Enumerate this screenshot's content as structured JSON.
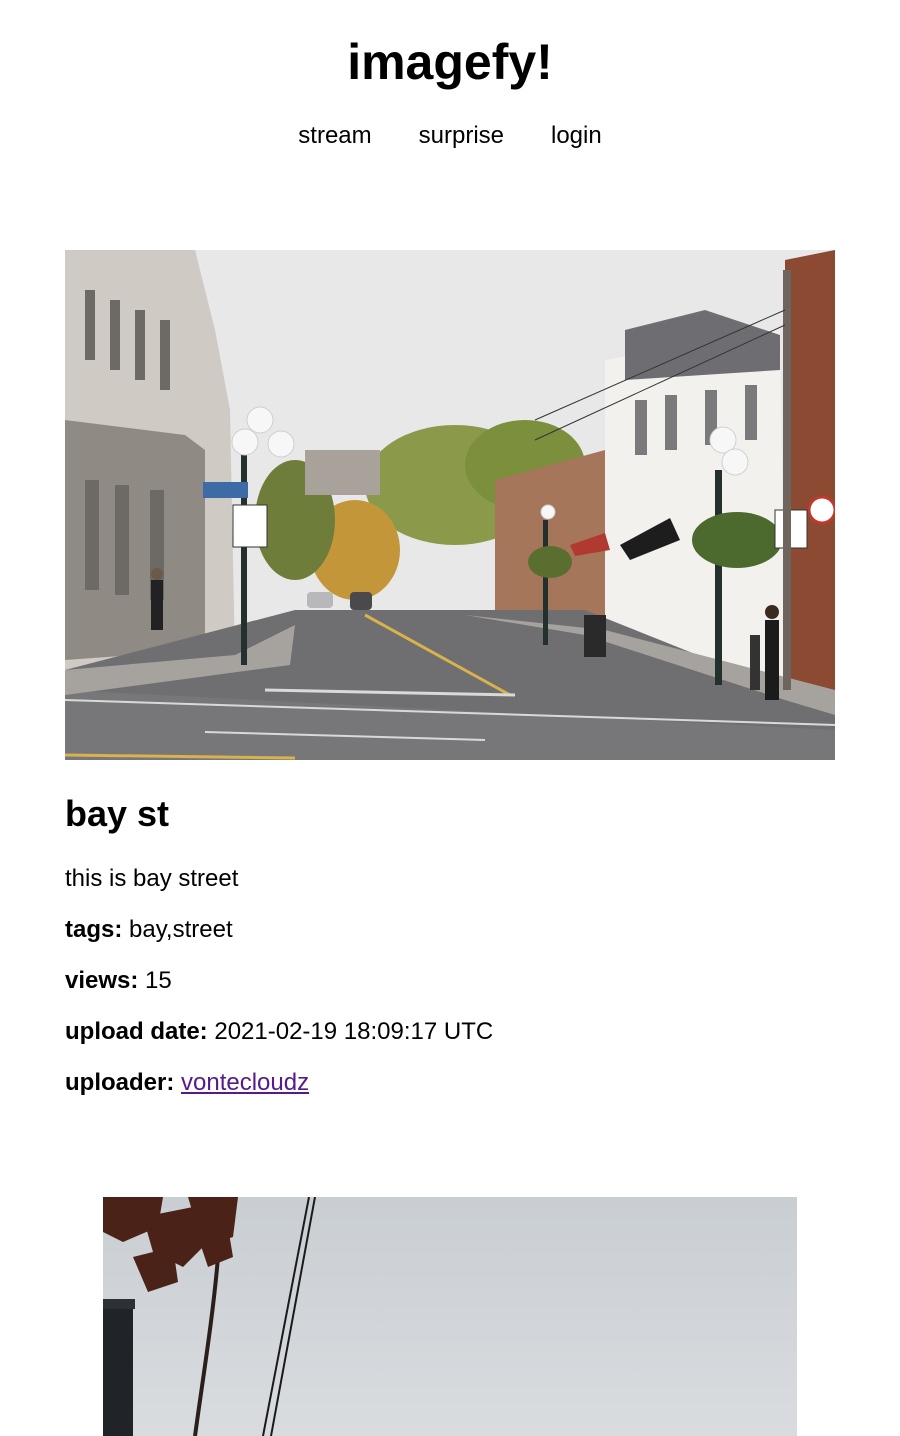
{
  "site": {
    "title": "imagefy!"
  },
  "nav": {
    "items": [
      {
        "label": "stream"
      },
      {
        "label": "surprise"
      },
      {
        "label": "login"
      }
    ]
  },
  "post": {
    "image_alt": "bay st",
    "title": "bay st",
    "description": "this is bay street",
    "tags_label": "tags:",
    "tags": "bay,street",
    "views_label": "views:",
    "views": "15",
    "upload_date_label": "upload date:",
    "upload_date": "2021-02-19 18:09:17 UTC",
    "uploader_label": "uploader:",
    "uploader": "vontecloudz"
  },
  "colors": {
    "link_visited": "#551A8B",
    "text": "#000000",
    "background": "#ffffff"
  }
}
